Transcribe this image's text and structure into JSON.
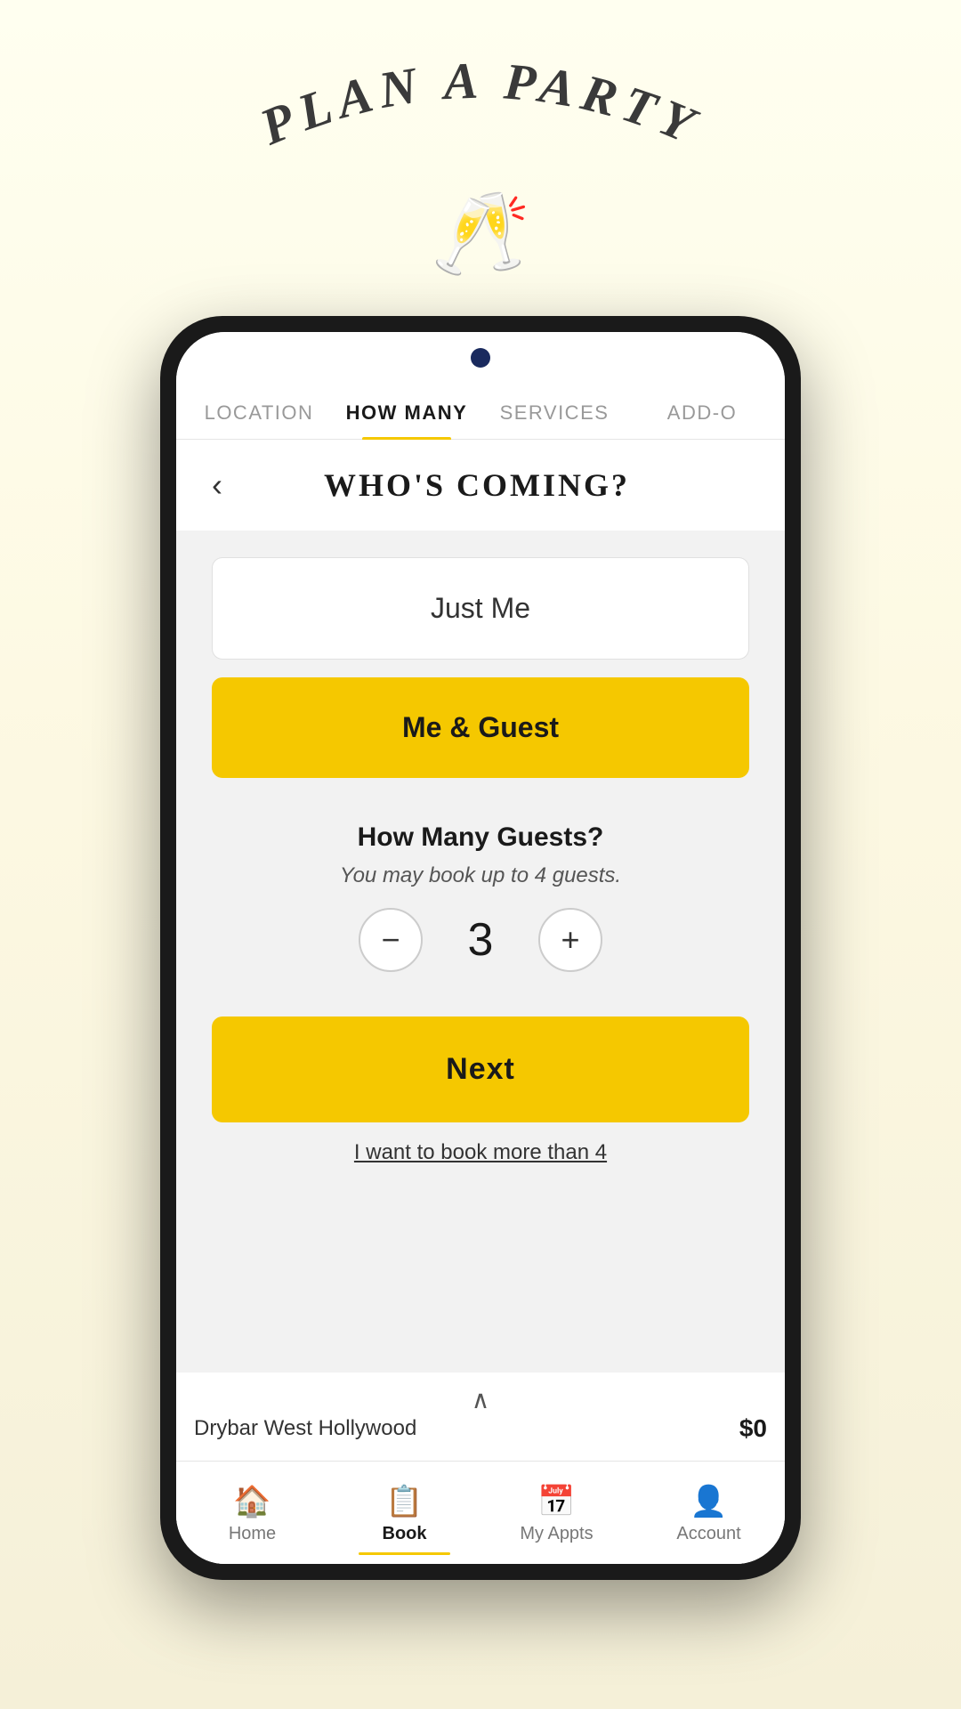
{
  "page": {
    "background_gradient_start": "#fffff0",
    "background_gradient_end": "#f5f0d8"
  },
  "header": {
    "title": "PLAN A PARTY",
    "champagne_icon": "🥂"
  },
  "nav_tabs": [
    {
      "id": "location",
      "label": "LOCATION",
      "active": false
    },
    {
      "id": "how_many",
      "label": "HOW MANY",
      "active": true
    },
    {
      "id": "services",
      "label": "SERVICES",
      "active": false
    },
    {
      "id": "add_ons",
      "label": "ADD-O",
      "active": false
    }
  ],
  "screen": {
    "title": "WHO'S COMING?",
    "back_label": "‹"
  },
  "options": [
    {
      "id": "just_me",
      "label": "Just Me",
      "active": false
    },
    {
      "id": "me_and_guest",
      "label": "Me & Guest",
      "active": true
    }
  ],
  "guest_count": {
    "title": "How Many Guests?",
    "subtitle": "You may book up to 4 guests.",
    "count": 3,
    "decrement_icon": "−",
    "increment_icon": "+"
  },
  "next_button": {
    "label": "Next"
  },
  "book_more_link": {
    "label": "I want to book more than 4"
  },
  "bottom_bar": {
    "chevron": "∧",
    "location": "Drybar West Hollywood",
    "price": "$0"
  },
  "tab_bar": [
    {
      "id": "home",
      "label": "Home",
      "icon": "🏠",
      "active": false
    },
    {
      "id": "book",
      "label": "Book",
      "icon": "📋",
      "active": true
    },
    {
      "id": "my_appts",
      "label": "My Appts",
      "icon": "📅",
      "active": false
    },
    {
      "id": "account",
      "label": "Account",
      "icon": "👤",
      "active": false
    }
  ]
}
